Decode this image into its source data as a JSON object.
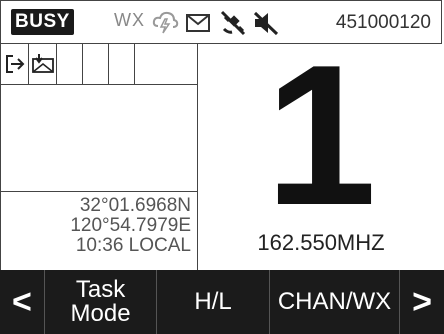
{
  "status": {
    "busy": "BUSY",
    "wx": "WX",
    "radio_id": "451000120",
    "icons": [
      "weather-alert-icon",
      "message-icon",
      "gps-off-icon",
      "mute-icon"
    ]
  },
  "left_panel": {
    "icons": [
      "exit-icon",
      "message-download-icon"
    ],
    "position": {
      "lat": "32°01.6968N",
      "lon": "120°54.7979E",
      "time": "10:36 LOCAL"
    }
  },
  "main": {
    "channel": "1",
    "frequency": "162.550MHZ"
  },
  "softkeys": {
    "prev": "<",
    "task_line1": "Task",
    "task_line2": "Mode",
    "hl": "H/L",
    "chan": "CHAN/WX",
    "next": ">"
  }
}
